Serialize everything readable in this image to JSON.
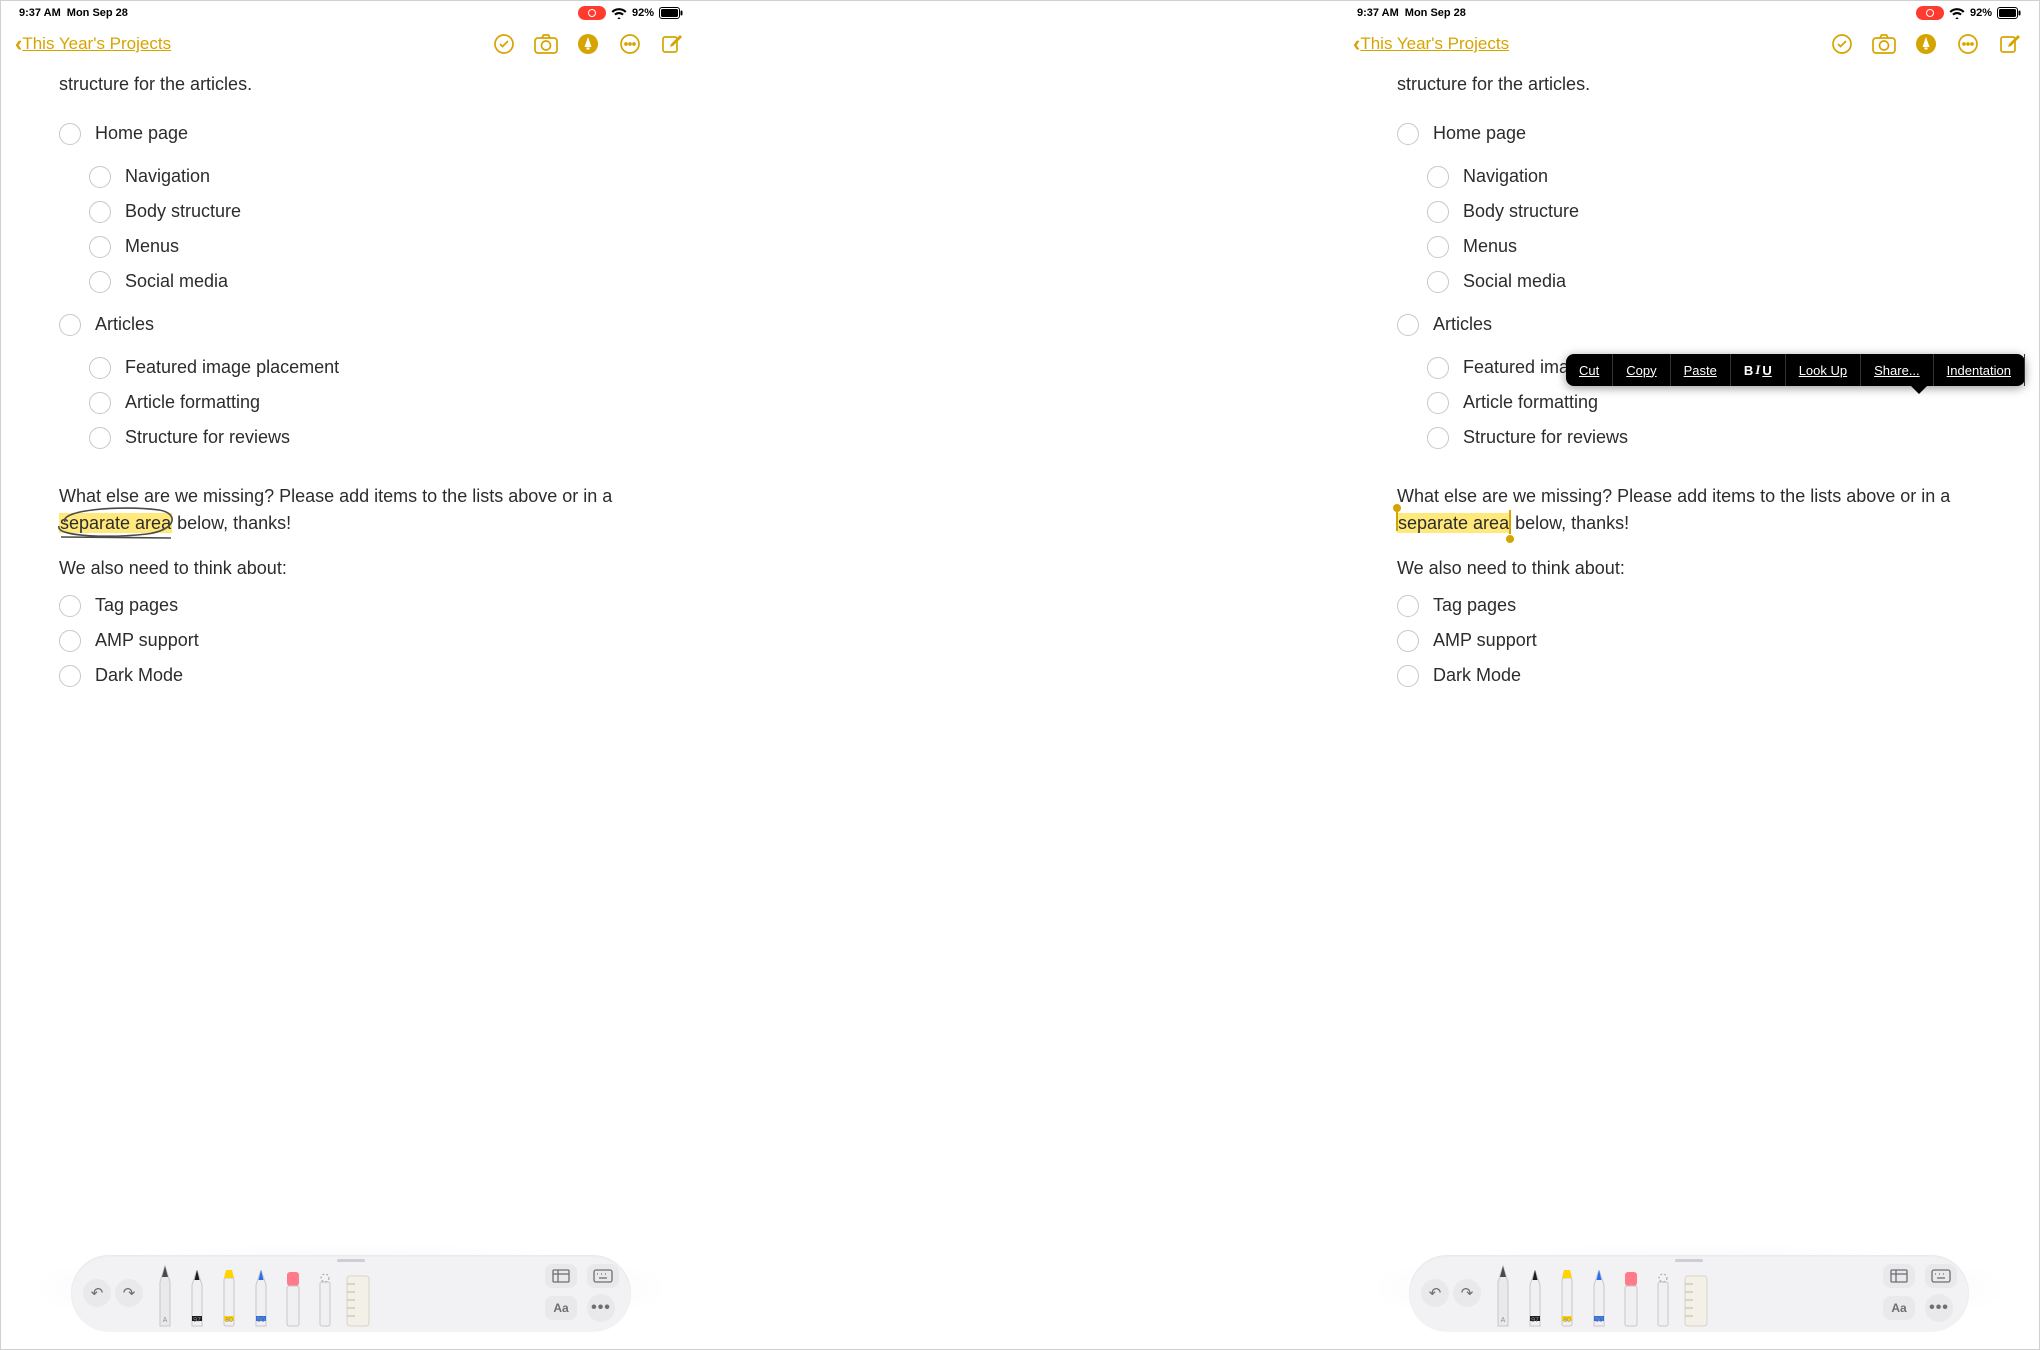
{
  "status": {
    "time": "9:37 AM",
    "date": "Mon Sep 28",
    "battery_pct": "92%"
  },
  "topbar": {
    "back": "This Year's Projects"
  },
  "content": {
    "intro": "structure for the articles.",
    "list1_header": "Home page",
    "list1": [
      "Navigation",
      "Body structure",
      "Menus",
      "Social media"
    ],
    "list2_header": "Articles",
    "list2": [
      "Featured image placement",
      "Article formatting",
      "Structure for reviews"
    ],
    "para1_pre": "What else are we missing? Please add items to the lists above or in a ",
    "para1_hl": "separate area",
    "para1_post": " below, thanks!",
    "para2": "We also need to think about:",
    "list3": [
      "Tag pages",
      "AMP support",
      "Dark Mode"
    ]
  },
  "context_menu": {
    "cut": "Cut",
    "copy": "Copy",
    "paste": "Paste",
    "biu_b": "B",
    "biu_i": "I",
    "biu_u": "U",
    "lookup": "Look Up",
    "share": "Share...",
    "indent": "Indentation"
  },
  "toolbar": {
    "aa": "Aa",
    "a": "A",
    "pencil_num": "97",
    "highlighter_num": "80",
    "bluepen_num": "50"
  }
}
